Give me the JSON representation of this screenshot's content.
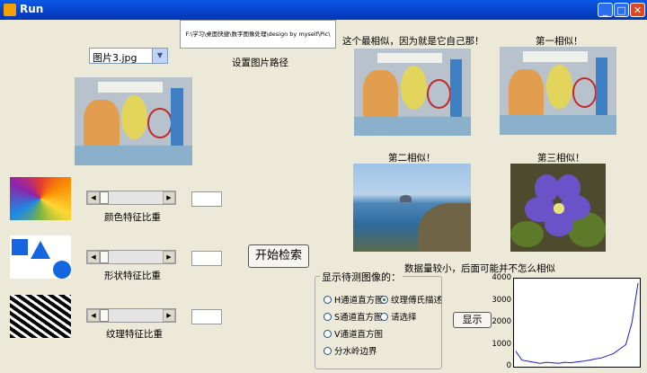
{
  "window": {
    "title": "Run"
  },
  "path": {
    "value": "F:\\学习\\桌面快捷\\数字图像处理\\design by myself\\Pic\\",
    "label": "设置图片路径"
  },
  "select": {
    "value": "图片3.jpg"
  },
  "captions": {
    "best": "这个最相似，因为就是它自己那！",
    "first": "第一相似！",
    "second": "第二相似！",
    "third": "第三相似！",
    "note": "数据量较小，后面可能并不怎么相似"
  },
  "weights": {
    "color_label": "颜色特征比重",
    "shape_label": "形状特征比重",
    "texture_label": "纹理特征比重",
    "color_value": "",
    "shape_value": "",
    "texture_value": ""
  },
  "buttons": {
    "search": "开始检索",
    "show": "显示"
  },
  "group": {
    "title": "显示待测图像的：",
    "options": [
      "H通道直方图",
      "纹理傅氏描述",
      "S通道直方图",
      "请选择",
      "V通道直方图",
      "分水岭边界"
    ],
    "selected": "纹理傅氏描述"
  },
  "chart_data": {
    "type": "line",
    "x": [
      0,
      5,
      10,
      15,
      20,
      25,
      30,
      35,
      40,
      45,
      50,
      55,
      60,
      65,
      70,
      75,
      80,
      85,
      90,
      95,
      100
    ],
    "values": [
      700,
      300,
      250,
      200,
      150,
      200,
      180,
      150,
      200,
      180,
      220,
      250,
      300,
      350,
      400,
      500,
      600,
      800,
      1000,
      2000,
      3800
    ],
    "yticks": [
      0,
      1000,
      2000,
      3000,
      4000
    ],
    "ylim": [
      0,
      4000
    ]
  },
  "colors": {
    "accent": "#0a5ae6",
    "plot_line": "#1a1ad6"
  }
}
